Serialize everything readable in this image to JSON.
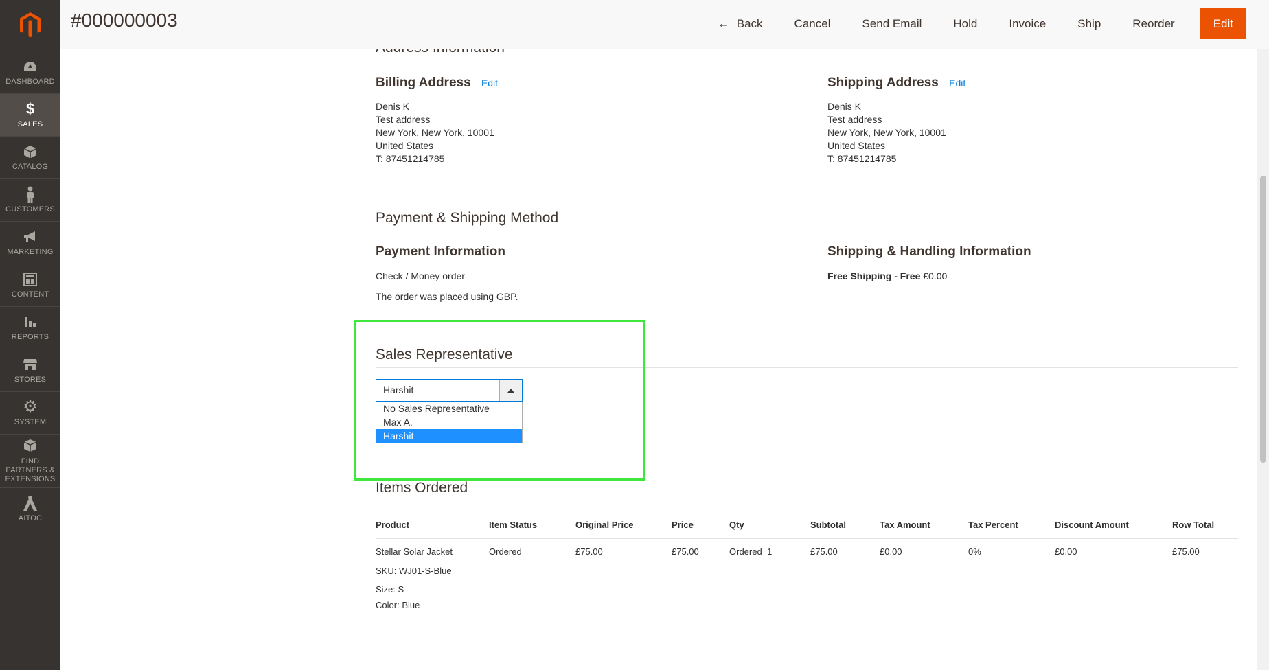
{
  "header": {
    "title": "#000000003",
    "actions": {
      "back": "Back",
      "cancel": "Cancel",
      "send_email": "Send Email",
      "hold": "Hold",
      "invoice": "Invoice",
      "ship": "Ship",
      "reorder": "Reorder",
      "edit": "Edit"
    }
  },
  "sidebar": {
    "items": [
      {
        "label": "Dashboard",
        "icon": "dashboard-icon"
      },
      {
        "label": "Sales",
        "icon": "dollar-icon"
      },
      {
        "label": "Catalog",
        "icon": "box-icon"
      },
      {
        "label": "Customers",
        "icon": "person-icon"
      },
      {
        "label": "Marketing",
        "icon": "megaphone-icon"
      },
      {
        "label": "Content",
        "icon": "layout-icon"
      },
      {
        "label": "Reports",
        "icon": "bar-chart-icon"
      },
      {
        "label": "Stores",
        "icon": "store-icon"
      },
      {
        "label": "System",
        "icon": "gear-icon"
      },
      {
        "label": "Find Partners & Extensions",
        "icon": "cubes-icon"
      },
      {
        "label": "Aitoc",
        "icon": "aitoc-icon"
      }
    ]
  },
  "address": {
    "section_title": "Address Information",
    "billing": {
      "title": "Billing Address",
      "edit": "Edit",
      "name": "Denis K",
      "street": "Test address",
      "city": "New York, New York, 10001",
      "country": "United States",
      "phone": "T: 87451214785"
    },
    "shipping": {
      "title": "Shipping Address",
      "edit": "Edit",
      "name": "Denis K",
      "street": "Test address",
      "city": "New York, New York, 10001",
      "country": "United States",
      "phone": "T: 87451214785"
    }
  },
  "payment": {
    "section_title": "Payment & Shipping Method",
    "payment_title": "Payment Information",
    "method": "Check / Money order",
    "note": "The order was placed using GBP.",
    "shipping_title": "Shipping & Handling Information",
    "shipping_method": "Free Shipping - Free",
    "shipping_price": "£0.00"
  },
  "sales_rep": {
    "section_title": "Sales Representative",
    "selected": "Harshit",
    "options": [
      "No Sales Representative",
      "Max A.",
      "Harshit"
    ]
  },
  "items": {
    "section_title": "Items Ordered",
    "columns": [
      "Product",
      "Item Status",
      "Original Price",
      "Price",
      "Qty",
      "Subtotal",
      "Tax Amount",
      "Tax Percent",
      "Discount Amount",
      "Row Total"
    ],
    "row": {
      "product": "Stellar Solar Jacket",
      "sku_label": "SKU:",
      "sku": "WJ01-S-Blue",
      "size_label": "Size:",
      "size": "S",
      "color_label": "Color:",
      "color": "Blue",
      "status": "Ordered",
      "original_price": "£75.00",
      "price": "£75.00",
      "qty_label": "Ordered",
      "qty": "1",
      "subtotal": "£75.00",
      "tax_amount": "£0.00",
      "tax_percent": "0%",
      "discount": "£0.00",
      "row_total": "£75.00"
    }
  },
  "colors": {
    "accent": "#eb5202",
    "sidebar": "#373330",
    "link": "#007bdb",
    "highlight": "#3fe63b"
  }
}
